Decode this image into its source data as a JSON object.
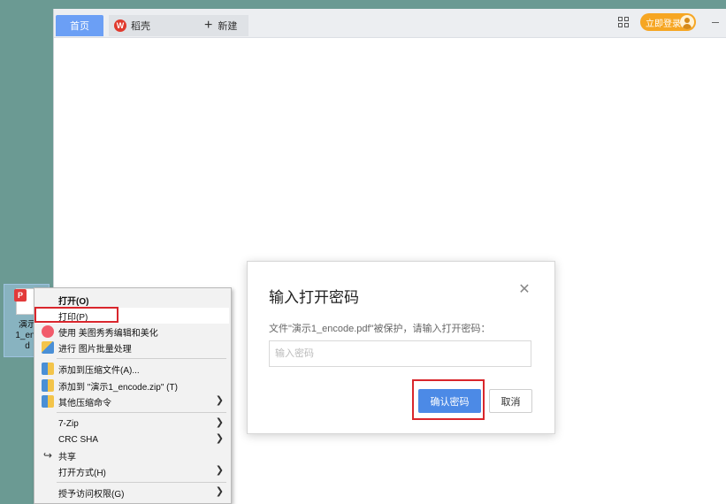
{
  "tabs": {
    "home": "首页",
    "daoke": "稻壳",
    "daoke_logo": "W",
    "new_tab": "新建"
  },
  "header": {
    "login": "立即登录"
  },
  "desktop_icon": {
    "badge": "P",
    "label": "演示\n1_enc\nd"
  },
  "context_menu": {
    "items": [
      {
        "label": "打开(O)"
      },
      {
        "label": "打印(P)"
      },
      {
        "label": "使用 美图秀秀编辑和美化"
      },
      {
        "label": "进行 图片批量处理"
      },
      {
        "label": "添加到压缩文件(A)..."
      },
      {
        "label": "添加到 \"演示1_encode.zip\" (T)"
      },
      {
        "label": "其他压缩命令"
      },
      {
        "label": "7-Zip"
      },
      {
        "label": "CRC SHA"
      },
      {
        "label": "共享"
      },
      {
        "label": "打开方式(H)"
      },
      {
        "label": "授予访问权限(G)"
      }
    ]
  },
  "dialog": {
    "title": "输入打开密码",
    "message": "文件\"演示1_encode.pdf\"被保护，请输入打开密码：",
    "input_placeholder": "输入密码",
    "confirm": "确认密码",
    "cancel": "取消"
  },
  "colors": {
    "accent": "#4c8ae6",
    "tab_active": "#6b9ff5",
    "login": "#f6a623",
    "highlight_box": "#d9262c",
    "desktop_bg": "#6b9a93"
  }
}
